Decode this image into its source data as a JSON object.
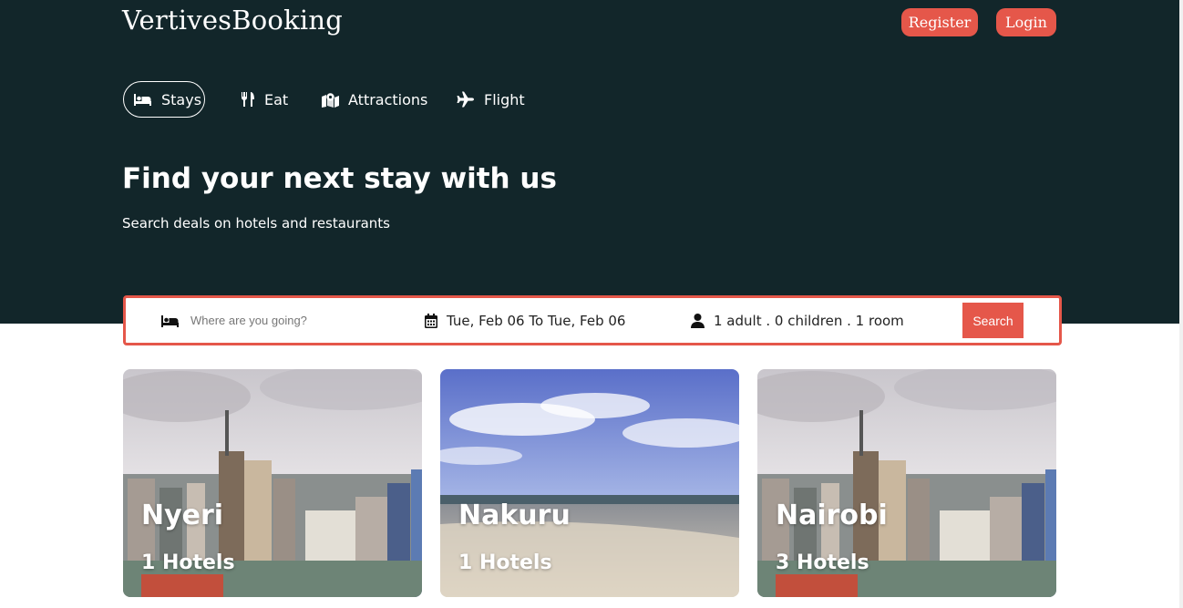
{
  "header": {
    "logo": "VertivesBooking",
    "register_label": "Register",
    "login_label": "Login"
  },
  "nav": {
    "items": [
      {
        "label": "Stays",
        "icon": "bed-icon",
        "active": true
      },
      {
        "label": "Eat",
        "icon": "utensils-icon",
        "active": false
      },
      {
        "label": "Attractions",
        "icon": "map-location-icon",
        "active": false
      },
      {
        "label": "Flight",
        "icon": "plane-icon",
        "active": false
      }
    ]
  },
  "hero": {
    "title": "Find your next stay with us",
    "subtitle": "Search deals on hotels and restaurants"
  },
  "search": {
    "destination_placeholder": "Where are you going?",
    "date_range": "Tue, Feb 06 To Tue, Feb 06",
    "guests": "1 adult . 0 children . 1 room",
    "button_label": "Search"
  },
  "cities": [
    {
      "name": "Nyeri",
      "hotels": "1 Hotels",
      "image": "city-skyline"
    },
    {
      "name": "Nakuru",
      "hotels": "1 Hotels",
      "image": "beach"
    },
    {
      "name": "Nairobi",
      "hotels": "3 Hotels",
      "image": "city-skyline"
    }
  ],
  "colors": {
    "header_bg": "#12262a",
    "accent": "#e5574a"
  }
}
